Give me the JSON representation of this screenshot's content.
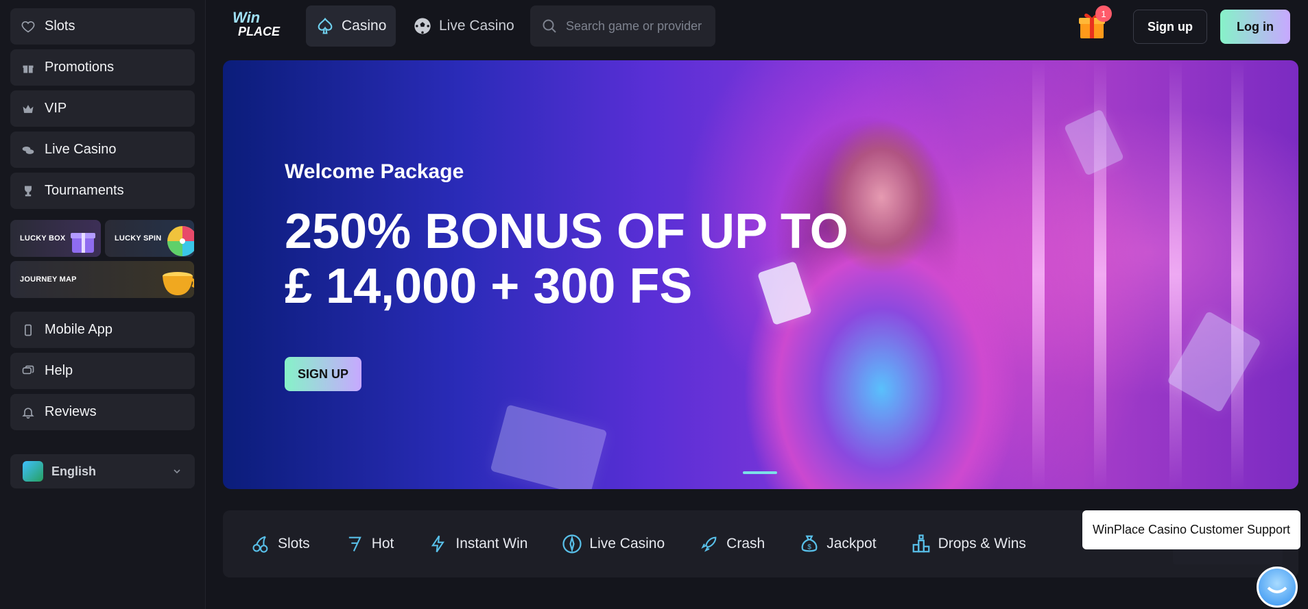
{
  "sidebar": {
    "items": [
      {
        "label": "Slots",
        "icon": "heart-icon"
      },
      {
        "label": "Promotions",
        "icon": "gift-icon"
      },
      {
        "label": "VIP",
        "icon": "crown-icon"
      },
      {
        "label": "Live Casino",
        "icon": "chips-icon"
      },
      {
        "label": "Tournaments",
        "icon": "trophy-icon"
      }
    ],
    "promos": {
      "lucky_box": "LUCKY BOX",
      "lucky_spin": "LUCKY SPIN",
      "journey_map": "JOURNEY MAP"
    },
    "bottom_items": [
      {
        "label": "Mobile App",
        "icon": "phone-icon"
      },
      {
        "label": "Help",
        "icon": "chat-bubble-icon"
      },
      {
        "label": "Reviews",
        "icon": "bell-icon"
      }
    ],
    "language": "English"
  },
  "header": {
    "logo_line1": "Win",
    "logo_line2": "PLACE",
    "tabs": [
      {
        "label": "Casino",
        "icon": "spade-icon"
      },
      {
        "label": "Live Casino",
        "icon": "football-icon"
      }
    ],
    "search_placeholder": "Search game or provider",
    "gift_badge": "1",
    "signup_label": "Sign up",
    "login_label": "Log in"
  },
  "banner": {
    "welcome": "Welcome Package",
    "headline_line1": "250% BONUS OF UP TO",
    "headline_line2": "£ 14,000 + 300 FS",
    "cta": "SIGN UP"
  },
  "categories": [
    {
      "label": "Slots",
      "icon": "cherries-icon"
    },
    {
      "label": "Hot",
      "icon": "seven-icon"
    },
    {
      "label": "Instant Win",
      "icon": "lightning-icon"
    },
    {
      "label": "Live Casino",
      "icon": "compass-icon"
    },
    {
      "label": "Crash",
      "icon": "rocket-icon"
    },
    {
      "label": "Jackpot",
      "icon": "money-bag-icon"
    },
    {
      "label": "Drops & Wins",
      "icon": "podium-icon"
    }
  ],
  "support": {
    "tooltip": "WinPlace Casino Customer Support"
  },
  "colors": {
    "accent_gradient_start": "#86f2c8",
    "accent_gradient_end": "#c7a8ff",
    "category_icon": "#58bfe8",
    "badge": "#ff5b6a"
  }
}
